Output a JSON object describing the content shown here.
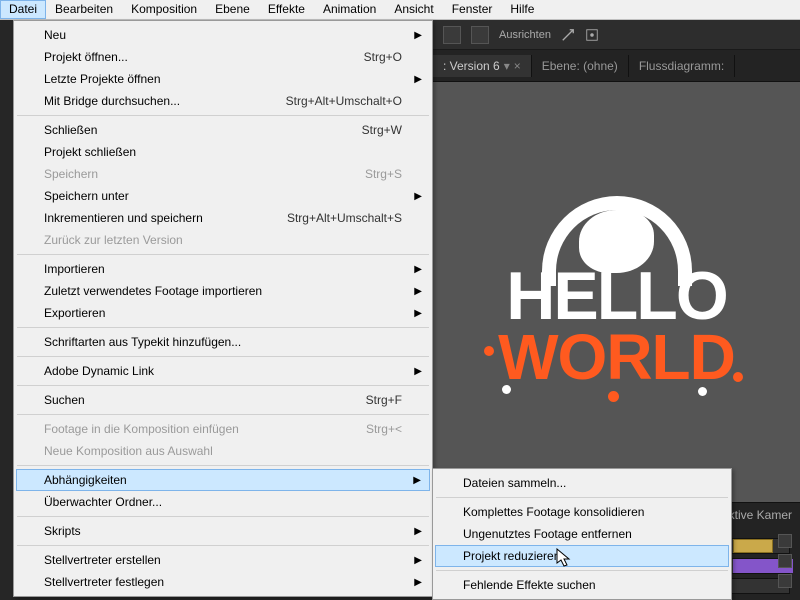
{
  "menubar": {
    "items": [
      "Datei",
      "Bearbeiten",
      "Komposition",
      "Ebene",
      "Effekte",
      "Animation",
      "Ansicht",
      "Fenster",
      "Hilfe"
    ]
  },
  "file_menu": [
    {
      "label": "Neu",
      "sub": true
    },
    {
      "label": "Projekt öffnen...",
      "shortcut": "Strg+O"
    },
    {
      "label": "Letzte Projekte öffnen",
      "sub": true
    },
    {
      "label": "Mit Bridge durchsuchen...",
      "shortcut": "Strg+Alt+Umschalt+O"
    },
    {
      "sep": true
    },
    {
      "label": "Schließen",
      "shortcut": "Strg+W"
    },
    {
      "label": "Projekt schließen"
    },
    {
      "label": "Speichern",
      "shortcut": "Strg+S",
      "disabled": true
    },
    {
      "label": "Speichern unter",
      "sub": true
    },
    {
      "label": "Inkrementieren und speichern",
      "shortcut": "Strg+Alt+Umschalt+S"
    },
    {
      "label": "Zurück zur letzten Version",
      "disabled": true
    },
    {
      "sep": true
    },
    {
      "label": "Importieren",
      "sub": true
    },
    {
      "label": "Zuletzt verwendetes Footage importieren",
      "sub": true
    },
    {
      "label": "Exportieren",
      "sub": true
    },
    {
      "sep": true
    },
    {
      "label": "Schriftarten aus Typekit hinzufügen..."
    },
    {
      "sep": true
    },
    {
      "label": "Adobe Dynamic Link",
      "sub": true
    },
    {
      "sep": true
    },
    {
      "label": "Suchen",
      "shortcut": "Strg+F"
    },
    {
      "sep": true
    },
    {
      "label": "Footage in die Komposition einfügen",
      "shortcut": "Strg+<",
      "disabled": true
    },
    {
      "label": "Neue Komposition aus Auswahl",
      "disabled": true
    },
    {
      "sep": true
    },
    {
      "label": "Abhängigkeiten",
      "sub": true,
      "highlight": true
    },
    {
      "label": "Überwachter Ordner..."
    },
    {
      "sep": true
    },
    {
      "label": "Skripts",
      "sub": true
    },
    {
      "sep": true
    },
    {
      "label": "Stellvertreter erstellen",
      "sub": true
    },
    {
      "label": "Stellvertreter festlegen",
      "sub": true
    }
  ],
  "submenu": [
    {
      "label": "Dateien sammeln..."
    },
    {
      "sep": true
    },
    {
      "label": "Komplettes Footage konsolidieren"
    },
    {
      "label": "Ungenutztes Footage entfernen"
    },
    {
      "label": "Projekt reduzieren",
      "highlight": true
    },
    {
      "sep": true
    },
    {
      "label": "Fehlende Effekte suchen"
    }
  ],
  "toolbar": {
    "align": "Ausrichten"
  },
  "tabs": {
    "comp": ": Version 6",
    "layer": "Ebene: (ohne)",
    "flow": "Flussdiagramm:"
  },
  "footer": {
    "active_cam": "Aktive Kamer"
  },
  "canvas": {
    "line1": "HELLO",
    "line2": "WORLD"
  }
}
